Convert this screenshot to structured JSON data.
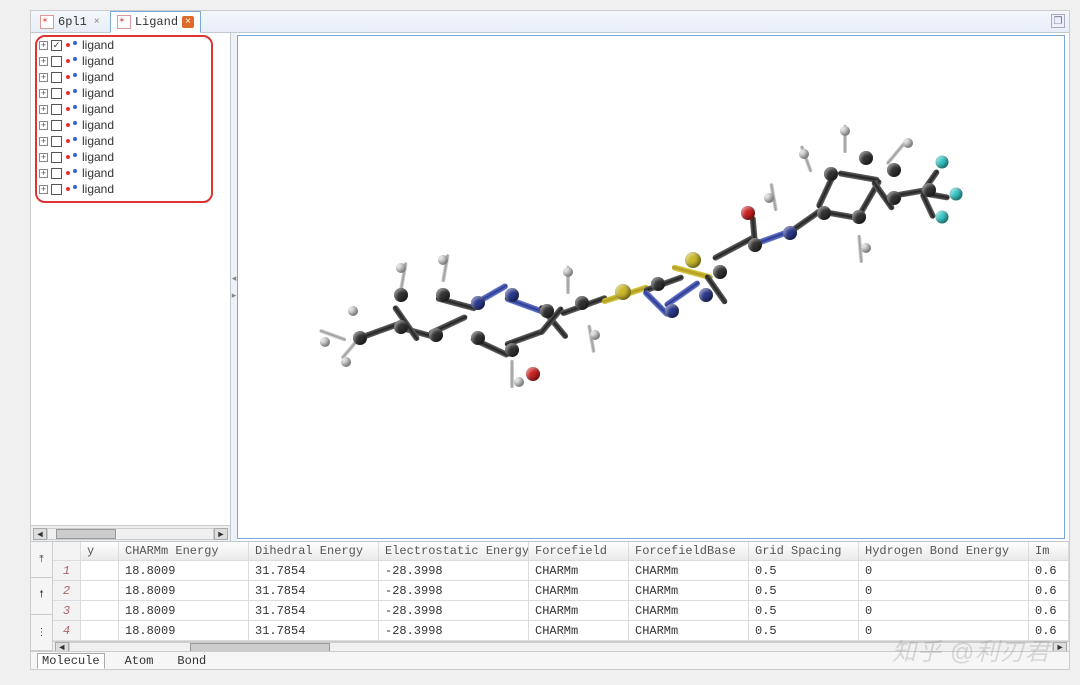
{
  "tabs": [
    {
      "label": "6pl1",
      "active": false
    },
    {
      "label": "Ligand",
      "active": true
    }
  ],
  "tree": {
    "items": [
      {
        "label": "ligand",
        "checked": true
      },
      {
        "label": "ligand",
        "checked": false
      },
      {
        "label": "ligand",
        "checked": false
      },
      {
        "label": "ligand",
        "checked": false
      },
      {
        "label": "ligand",
        "checked": false
      },
      {
        "label": "ligand",
        "checked": false
      },
      {
        "label": "ligand",
        "checked": false
      },
      {
        "label": "ligand",
        "checked": false
      },
      {
        "label": "ligand",
        "checked": false
      },
      {
        "label": "ligand",
        "checked": false
      }
    ]
  },
  "table": {
    "columns": [
      "y",
      "CHARMm Energy",
      "Dihedral Energy",
      "Electrostatic Energy",
      "Forcefield",
      "ForcefieldBase",
      "Grid Spacing",
      "Hydrogen Bond Energy",
      "Im"
    ],
    "rows": [
      {
        "n": "1",
        "y": "",
        "charmm": "18.8009",
        "dihedral": "31.7854",
        "elec": "-28.3998",
        "ff": "CHARMm",
        "ffb": "CHARMm",
        "grid": "0.5",
        "hb": "0",
        "im": "0.6"
      },
      {
        "n": "2",
        "y": "",
        "charmm": "18.8009",
        "dihedral": "31.7854",
        "elec": "-28.3998",
        "ff": "CHARMm",
        "ffb": "CHARMm",
        "grid": "0.5",
        "hb": "0",
        "im": "0.6"
      },
      {
        "n": "3",
        "y": "",
        "charmm": "18.8009",
        "dihedral": "31.7854",
        "elec": "-28.3998",
        "ff": "CHARMm",
        "ffb": "CHARMm",
        "grid": "0.5",
        "hb": "0",
        "im": "0.6"
      },
      {
        "n": "4",
        "y": "",
        "charmm": "18.8009",
        "dihedral": "31.7854",
        "elec": "-28.3998",
        "ff": "CHARMm",
        "ffb": "CHARMm",
        "grid": "0.5",
        "hb": "0",
        "im": "0.6"
      }
    ]
  },
  "bottom_tabs": [
    "Molecule",
    "Atom",
    "Bond"
  ],
  "watermark": "知乎 @利刃君"
}
